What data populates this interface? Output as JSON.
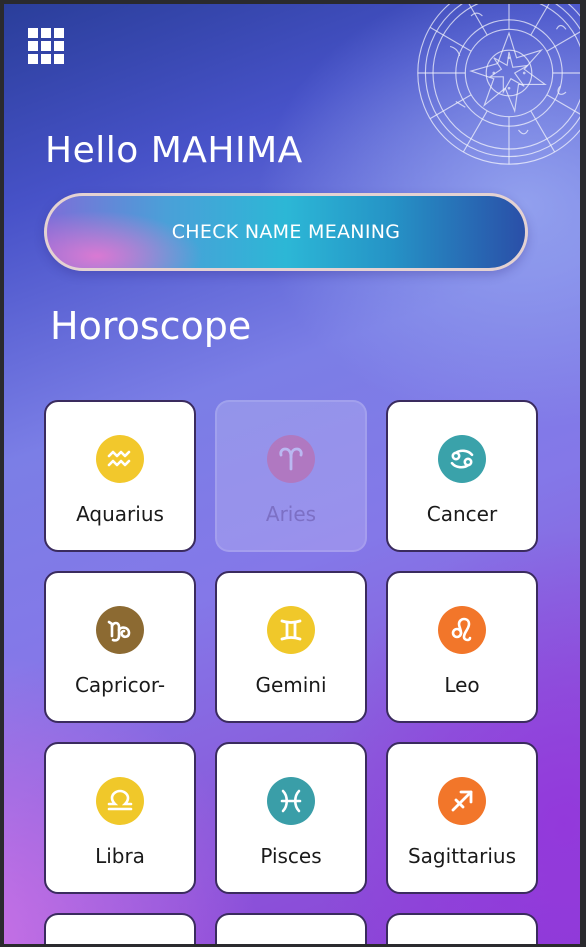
{
  "header": {
    "greeting": "Hello MAHIMA"
  },
  "cta": {
    "label": "CHECK NAME MEANING"
  },
  "horoscope": {
    "title": "Horoscope",
    "signs": [
      {
        "label": "Aquarius",
        "icon": "aquarius-icon",
        "color": "#f2c82c",
        "state": "normal"
      },
      {
        "label": "Aries",
        "icon": "aries-icon",
        "color": "#e04a74",
        "state": "disabled"
      },
      {
        "label": "Cancer",
        "icon": "cancer-icon",
        "color": "#3aa2aa",
        "state": "normal"
      },
      {
        "label": "Capricor-",
        "icon": "capricorn-icon",
        "color": "#8c6a32",
        "state": "normal"
      },
      {
        "label": "Gemini",
        "icon": "gemini-icon",
        "color": "#f0c82a",
        "state": "normal"
      },
      {
        "label": "Leo",
        "icon": "leo-icon",
        "color": "#f2762a",
        "state": "normal"
      },
      {
        "label": "Libra",
        "icon": "libra-icon",
        "color": "#f0c82a",
        "state": "normal"
      },
      {
        "label": "Pisces",
        "icon": "pisces-icon",
        "color": "#3a9ea8",
        "state": "normal"
      },
      {
        "label": "Sagittarius",
        "icon": "sagittarius-icon",
        "color": "#f2762a",
        "state": "normal"
      }
    ]
  }
}
